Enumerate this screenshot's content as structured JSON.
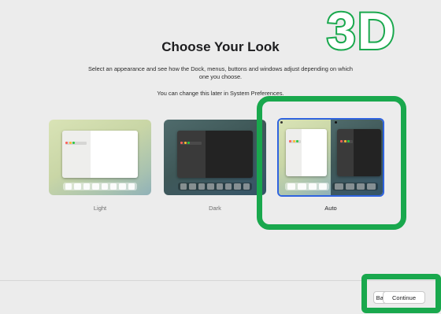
{
  "header": {
    "title": "Choose Your Look",
    "description_line1": "Select an appearance and see how the Dock, menus, buttons and windows adjust depending on which",
    "description_line2": "one you choose.",
    "note": "You can change this later in System Preferences."
  },
  "appearances": [
    {
      "label": "Light",
      "selected": false
    },
    {
      "label": "Dark",
      "selected": false
    },
    {
      "label": "Auto",
      "selected": true
    }
  ],
  "footer": {
    "back_label": "Back",
    "continue_label": "Continue"
  },
  "overlay": {
    "badge_text": "3D"
  },
  "colors": {
    "selection_border": "#2f63df",
    "highlight_green": "#19a84d",
    "background": "#ececec"
  }
}
